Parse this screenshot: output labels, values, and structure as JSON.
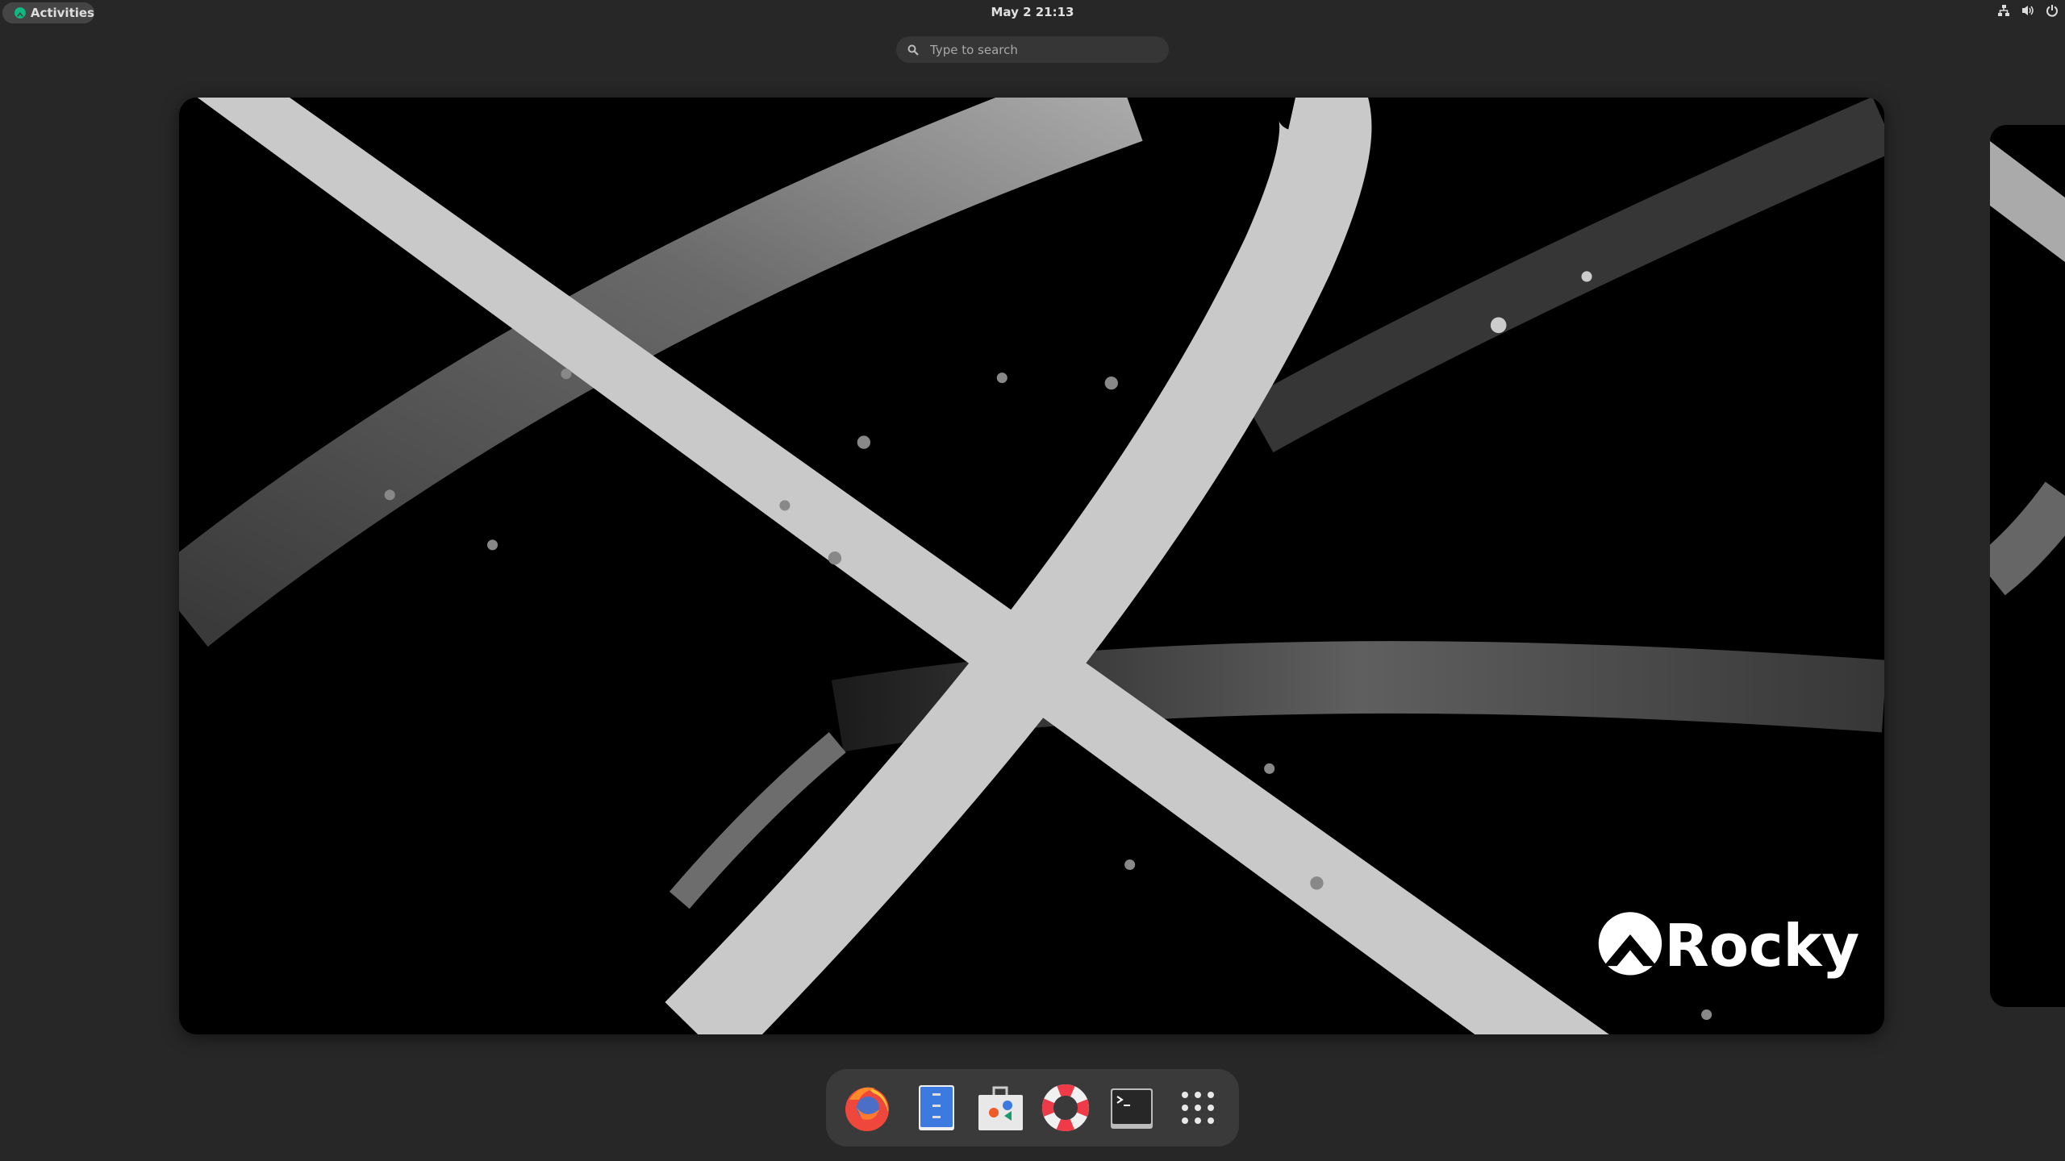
{
  "topbar": {
    "activities_label": "Activities",
    "clock": "May 2  21:13",
    "tray_icons": [
      "network-wired-icon",
      "volume-icon",
      "power-icon"
    ],
    "accent_color": "#10b981"
  },
  "search": {
    "placeholder": "Type to search",
    "value": ""
  },
  "workspace": {
    "logo_text": "Rocky"
  },
  "dock": {
    "items": [
      {
        "name": "Firefox",
        "icon": "firefox-icon"
      },
      {
        "name": "Files",
        "icon": "files-icon"
      },
      {
        "name": "Software",
        "icon": "software-store-icon"
      },
      {
        "name": "Help",
        "icon": "help-lifebuoy-icon"
      },
      {
        "name": "Terminal",
        "icon": "terminal-icon"
      },
      {
        "name": "Show Applications",
        "icon": "app-grid-icon"
      }
    ]
  }
}
